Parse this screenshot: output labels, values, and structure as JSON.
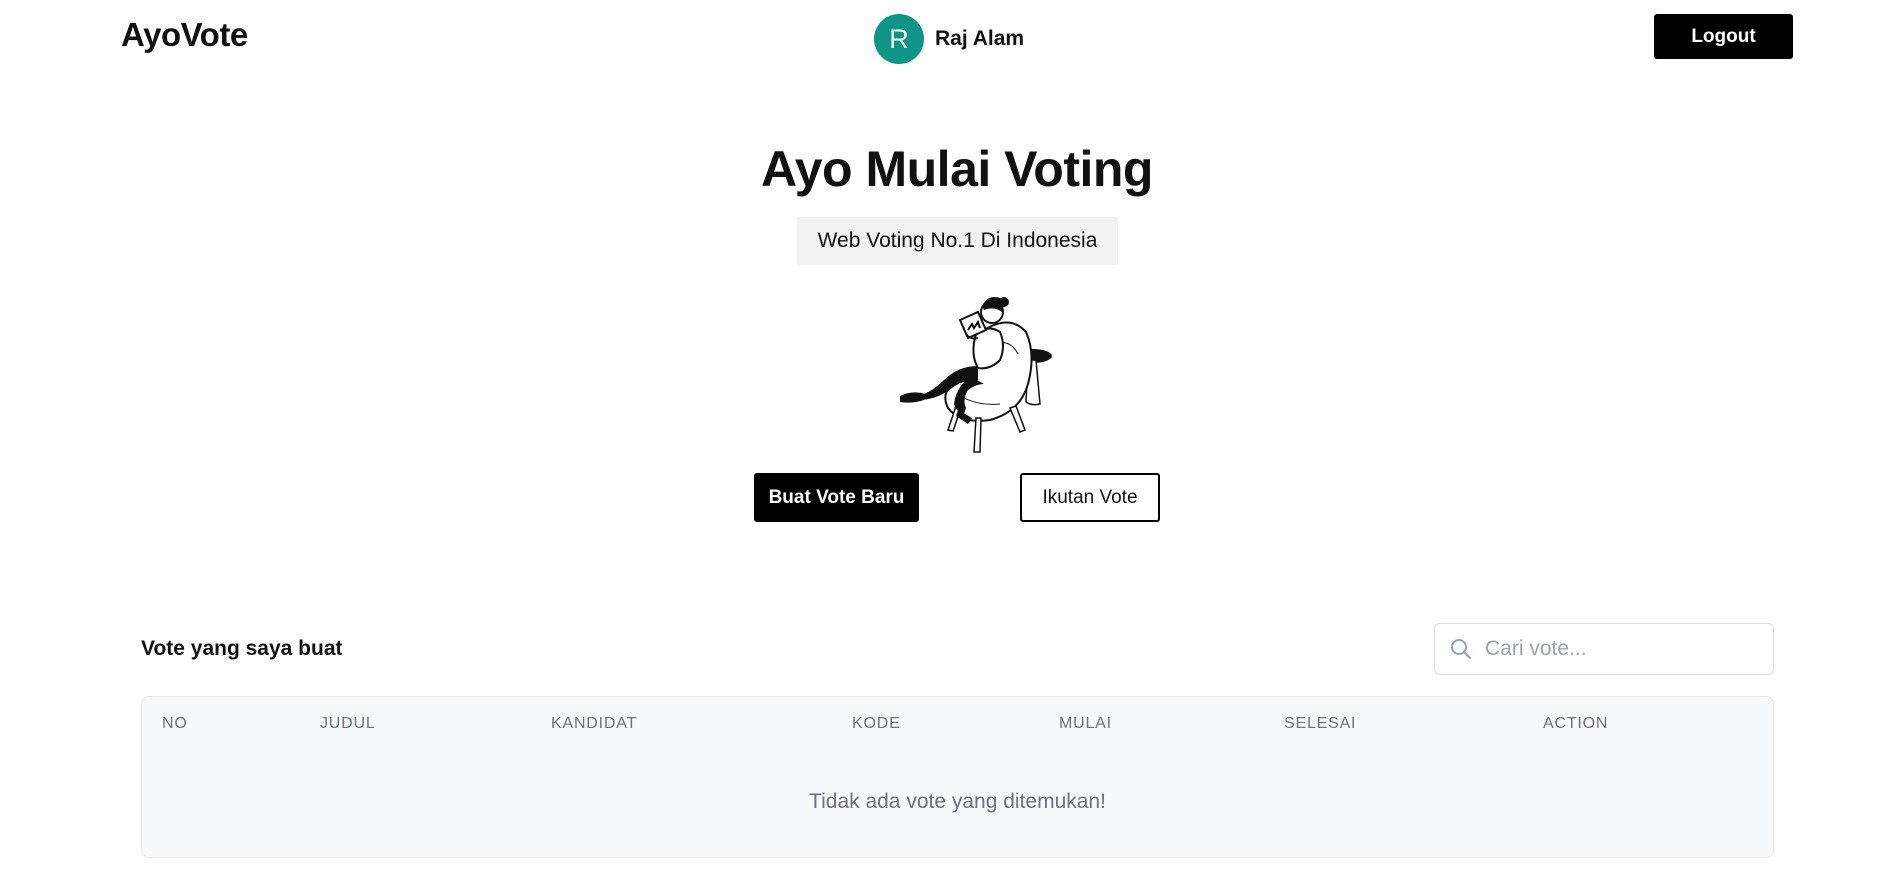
{
  "header": {
    "brand": "AyoVote",
    "user": {
      "initial": "R",
      "name": "Raj Alam"
    },
    "logout_label": "Logout"
  },
  "hero": {
    "title": "Ayo Mulai Voting",
    "tagline": "Web Voting No.1 Di Indonesia",
    "illustration": "woman-reading-in-armchair-illustration",
    "primary_button": "Buat Vote Baru",
    "secondary_button": "Ikutan Vote"
  },
  "votes_section": {
    "title": "Vote yang saya buat",
    "search": {
      "placeholder": "Cari vote...",
      "value": ""
    },
    "table": {
      "columns": [
        "NO",
        "JUDUL",
        "KANDIDAT",
        "KODE",
        "MULAI",
        "SELESAI",
        "ACTION"
      ],
      "rows": [],
      "empty_message": "Tidak ada vote yang ditemukan!"
    }
  },
  "colors": {
    "avatar_bg": "#0f9488",
    "primary": "#000000",
    "muted_text": "#6b7280",
    "table_bg": "#f8f9fa"
  }
}
